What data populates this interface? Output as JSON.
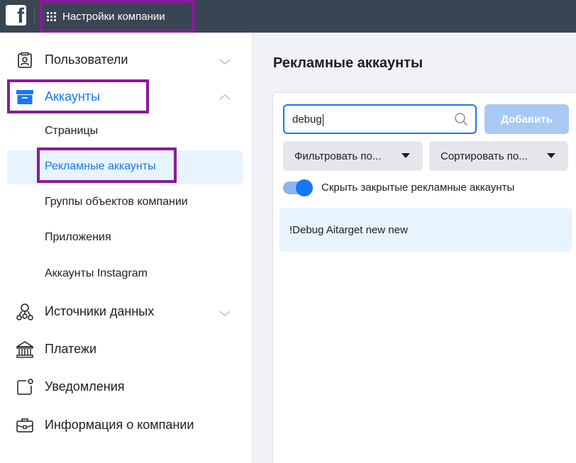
{
  "topbar": {
    "logo_letter": "f",
    "app_title": "Настройки компании"
  },
  "sidebar": {
    "users": {
      "label": "Пользователи",
      "icon": "users-id-card-icon"
    },
    "accounts": {
      "label": "Аккаунты",
      "icon": "accounts-box-icon",
      "sub_items": [
        "Страницы",
        "Рекламные аккаунты",
        "Группы объектов компании",
        "Приложения",
        "Аккаунты Instagram"
      ],
      "selected": "Рекламные аккаунты"
    },
    "data_sources": {
      "label": "Источники данных",
      "icon": "data-sources-icon"
    },
    "payments": {
      "label": "Платежи",
      "icon": "bank-icon"
    },
    "notifications": {
      "label": "Уведомления",
      "icon": "notification-icon"
    },
    "company_info": {
      "label": "Информация о компании",
      "icon": "briefcase-icon"
    }
  },
  "main": {
    "title": "Рекламные аккаунты",
    "search": {
      "value": "debug"
    },
    "add_button": "Добавить",
    "filter_dropdown": "Фильтровать по...",
    "sort_dropdown": "Сортировать по...",
    "hide_closed_toggle": {
      "label": "Скрыть закрытые рекламные аккаунты",
      "on": true
    },
    "results": [
      "!Debug Aitarget new new"
    ]
  },
  "colors": {
    "topbar": "#3a4554",
    "accent": "#1877f2",
    "highlight": "#8b1a9b",
    "selected_bg": "#e7f3ff"
  }
}
